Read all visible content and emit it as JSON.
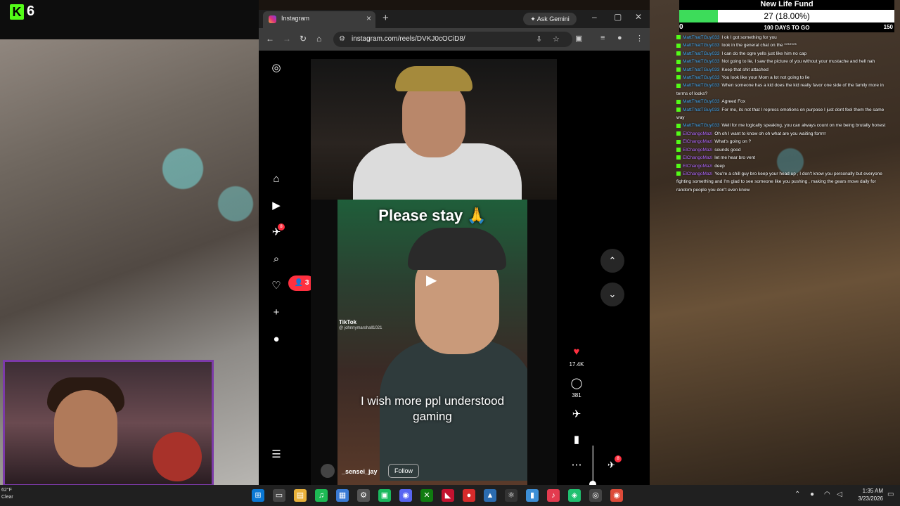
{
  "stream": {
    "viewer_count": "6",
    "goal": {
      "title": "New Life Fund",
      "progress_text": "27 (18.00%)",
      "progress_percent": 18,
      "min": "0",
      "max": "150",
      "days_left": "100 DAYS TO GO"
    },
    "chat": [
      {
        "user": "MattThatTGuy033",
        "text": "I ok I got something for you",
        "color": "#3fa9f5"
      },
      {
        "user": "MattThatTGuy033",
        "text": "look in the general chat on the *******",
        "color": "#3fa9f5"
      },
      {
        "user": "MattThatTGuy033",
        "text": "I can do the ogre yells just like him no cap",
        "color": "#3fa9f5"
      },
      {
        "user": "MattThatTGuy033",
        "text": "Not going to lie, I saw the picture of you without your mustache and hell nah",
        "color": "#3fa9f5"
      },
      {
        "user": "MattThatTGuy033",
        "text": "Keep that shit attached",
        "color": "#3fa9f5"
      },
      {
        "user": "MattThatTGuy033",
        "text": "You look like your Mom a lot not going to lie",
        "color": "#3fa9f5"
      },
      {
        "user": "MattThatTGuy033",
        "text": "When someone has a kid does the kid really favor one side of the family more in terms of looks?",
        "color": "#3fa9f5"
      },
      {
        "user": "MattThatTGuy033",
        "text": "Agreed Fox",
        "color": "#3fa9f5"
      },
      {
        "user": "MattThatTGuy033",
        "text": "For me, its not that I repress emotions on purpose I just dont feel them the same way",
        "color": "#3fa9f5"
      },
      {
        "user": "MattThatTGuy033",
        "text": "Well for me logically speaking, you can always count on me being brutally honest",
        "color": "#3fa9f5"
      },
      {
        "user": "ElChangoMazi",
        "text": "Oh oh I want to know oh oh what are you waiting forrrrr",
        "color": "#b067ff"
      },
      {
        "user": "ElChangoMazi",
        "text": "What's going on ?",
        "color": "#b067ff"
      },
      {
        "user": "ElChangoMazi",
        "text": "sounds good",
        "color": "#b067ff"
      },
      {
        "user": "ElChangoMazi",
        "text": "let me hear bro vent",
        "color": "#b067ff"
      },
      {
        "user": "ElChangoMazi",
        "text": "deep",
        "color": "#b067ff"
      },
      {
        "user": "ElChangoMazi",
        "text": "You're a chill guy bro keep your head up , I don't know you personally but everyone fighting something and I'm glad to see someone like you pushing , making the gears move daily for random people you don't even know",
        "color": "#b067ff"
      }
    ]
  },
  "browser": {
    "tab_title": "Instagram",
    "ask_gemini": "Ask Gemini",
    "url": "instagram.com/reels/DVKJ0cOCiD8/"
  },
  "reel": {
    "caption_top": "Please stay 🙏",
    "caption_bottom": "I wish more ppl understood gaming",
    "watermark": "TikTok",
    "watermark_user": "@ johnnymarshall1021",
    "username": "_sensei_jay",
    "follow_label": "Follow",
    "likes": "17.4K",
    "comments": "381",
    "notification_count": "3",
    "nav_badge": "8",
    "messages_badge": "8"
  },
  "taskbar": {
    "weather_temp": "62°F",
    "weather_cond": "Clear",
    "time": "1:35 AM",
    "date": "3/23/2026"
  }
}
